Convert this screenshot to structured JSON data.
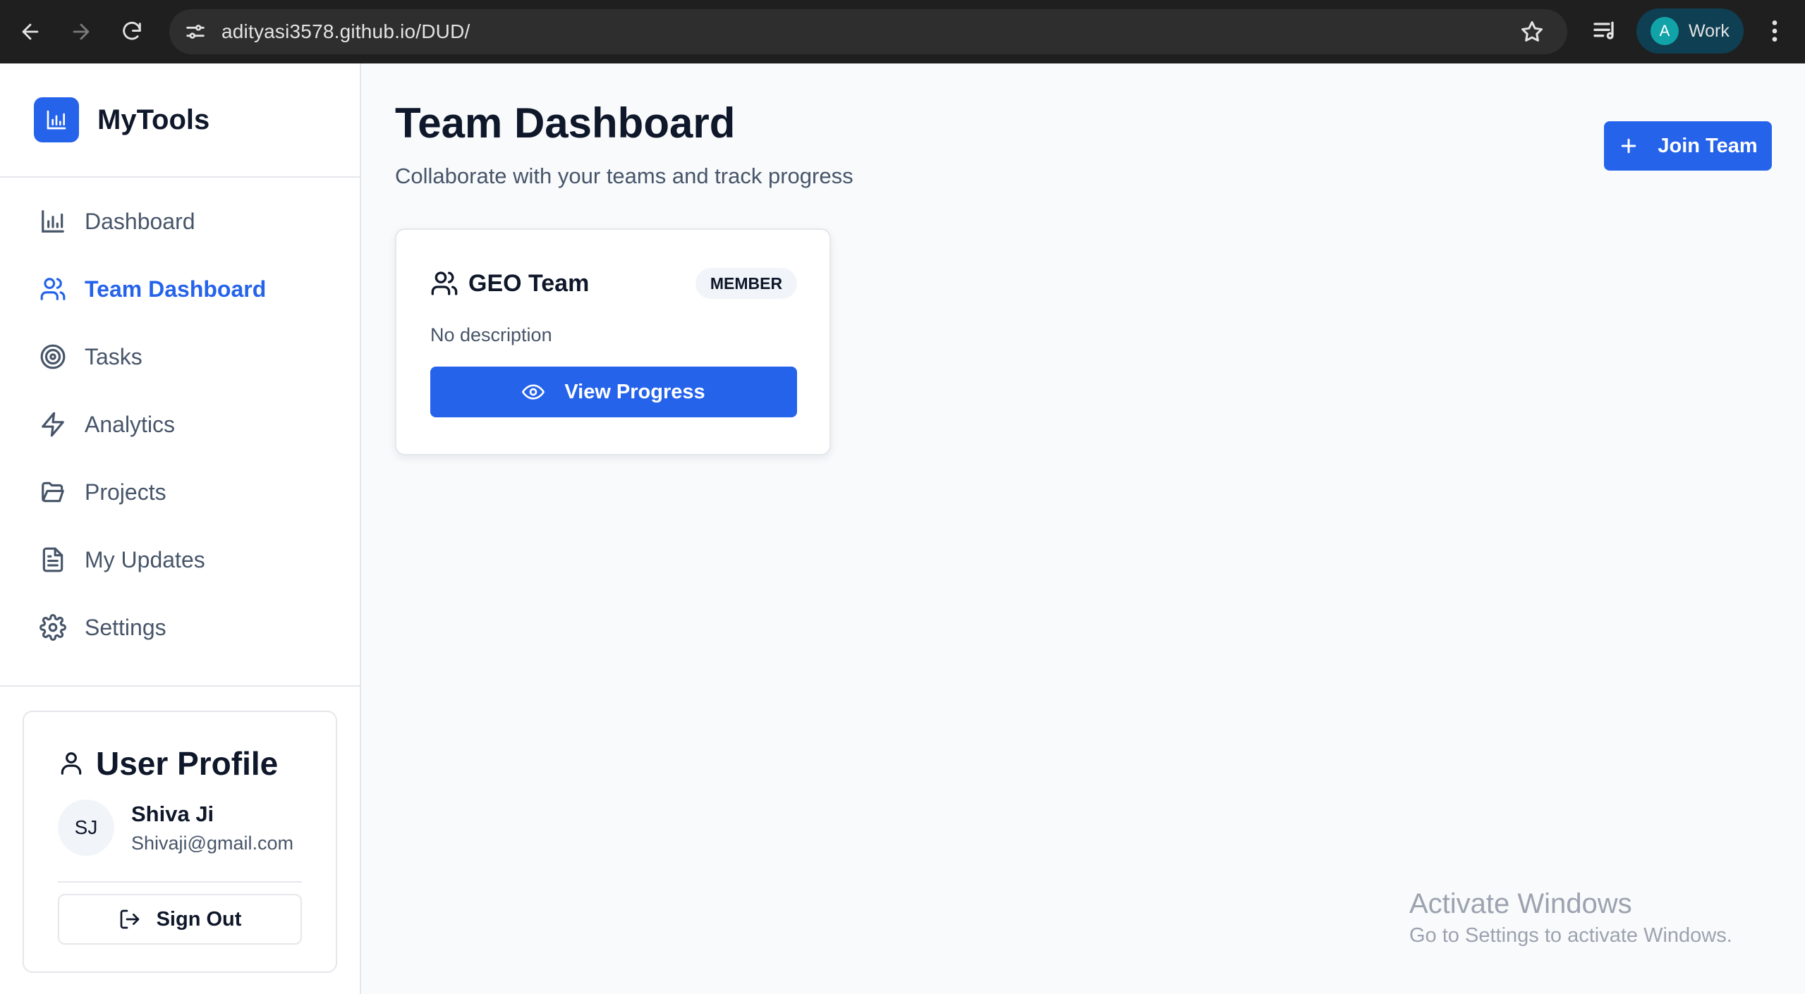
{
  "browser": {
    "url": "adityasi3578.github.io/DUD/",
    "profile_initial": "A",
    "profile_label": "Work"
  },
  "sidebar": {
    "brand": "MyTools",
    "items": [
      {
        "label": "Dashboard",
        "icon": "bar-chart-icon"
      },
      {
        "label": "Team Dashboard",
        "icon": "users-icon",
        "active": true
      },
      {
        "label": "Tasks",
        "icon": "target-icon"
      },
      {
        "label": "Analytics",
        "icon": "zap-icon"
      },
      {
        "label": "Projects",
        "icon": "folder-open-icon"
      },
      {
        "label": "My Updates",
        "icon": "file-text-icon"
      },
      {
        "label": "Settings",
        "icon": "gear-icon"
      }
    ],
    "profile": {
      "title": "User Profile",
      "initials": "SJ",
      "name": "Shiva Ji",
      "email": "Shivaji@gmail.com",
      "sign_out": "Sign Out"
    }
  },
  "main": {
    "title": "Team Dashboard",
    "subtitle": "Collaborate with your teams and track progress",
    "join_button": "Join Team",
    "teams": [
      {
        "name": "GEO Team",
        "role": "MEMBER",
        "description": "No description",
        "action": "View Progress"
      }
    ]
  },
  "watermark": {
    "title": "Activate Windows",
    "subtitle": "Go to Settings to activate Windows."
  },
  "colors": {
    "accent": "#2563eb",
    "chrome_bg": "#1f1f1f",
    "page_bg": "#f8fafc"
  }
}
